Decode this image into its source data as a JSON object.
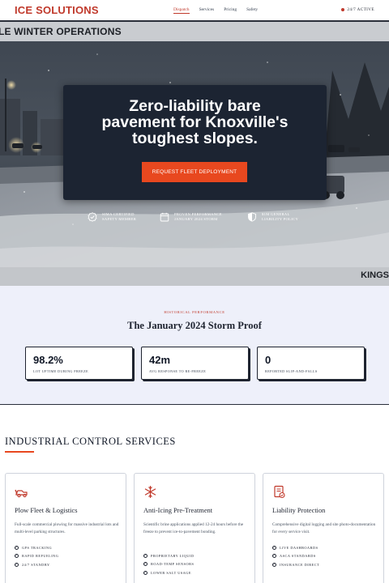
{
  "nav": {
    "logo": "ICE SOLUTIONS",
    "links": [
      {
        "label": "Dispatch",
        "active": true
      },
      {
        "label": "Services",
        "active": false
      },
      {
        "label": "Pricing",
        "active": false
      },
      {
        "label": "Safety",
        "active": false
      }
    ],
    "status": "24/7 ACTIVE"
  },
  "hero": {
    "top_banner": "LE WINTER OPERATIONS",
    "bottom_banner": "KINGS",
    "title_line1": "Zero-liability bare",
    "title_line2": "pavement for Knoxville's",
    "title_line3": "toughest slopes.",
    "cta": "REQUEST FLEET DEPLOYMENT",
    "badges": [
      {
        "icon": "check-badge-icon",
        "line1": "SIMA CERTIFIED",
        "line2": "SAFETY MEMBER"
      },
      {
        "icon": "calendar-icon",
        "line1": "PROVEN PERFORMANCE",
        "line2": "JANUARY 2024 STORM"
      },
      {
        "icon": "shield-icon",
        "line1": "$1M GENERAL",
        "line2": "LIABILITY POLICY"
      }
    ]
  },
  "proof": {
    "eyebrow": "HISTORICAL PERFORMANCE",
    "title": "The January 2024 Storm Proof",
    "stats": [
      {
        "value": "98.2%",
        "label": "LOT UPTIME DURING FREEZE"
      },
      {
        "value": "42m",
        "label": "AVG RESPONSE TO RE-FREEZE"
      },
      {
        "value": "0",
        "label": "REPORTED SLIP-AND-FALLS"
      }
    ]
  },
  "services": {
    "title": "INDUSTRIAL CONTROL SERVICES",
    "cards": [
      {
        "icon": "plow-truck-icon",
        "title": "Plow Fleet & Logistics",
        "desc": "Full-scale commercial plowing for massive industrial lots and multi-level parking structures.",
        "items": [
          "GPS TRACKING",
          "RAPID REFUELING",
          "24/7 STANDBY"
        ]
      },
      {
        "icon": "snowflake-icon",
        "title": "Anti-Icing Pre-Treatment",
        "desc": "Scientific brine applications applied 12-24 hours before the freeze to prevent ice-to-pavement bonding.",
        "items": [
          "PROPRIETARY LIQUID",
          "ROAD-TEMP SENSORS",
          "LOWER SALT USAGE"
        ]
      },
      {
        "icon": "document-check-icon",
        "title": "Liability Protection",
        "desc": "Comprehensive digital logging and site photo-documentation for every service visit.",
        "items": [
          "LIVE DASHBOARDS",
          "ASCA STANDARDS",
          "INSURANCE DIRECT"
        ]
      }
    ]
  },
  "colors": {
    "accent": "#e8481f",
    "brand": "#c0392b",
    "navy": "#1c2432",
    "section_bg": "#eef0fa"
  }
}
